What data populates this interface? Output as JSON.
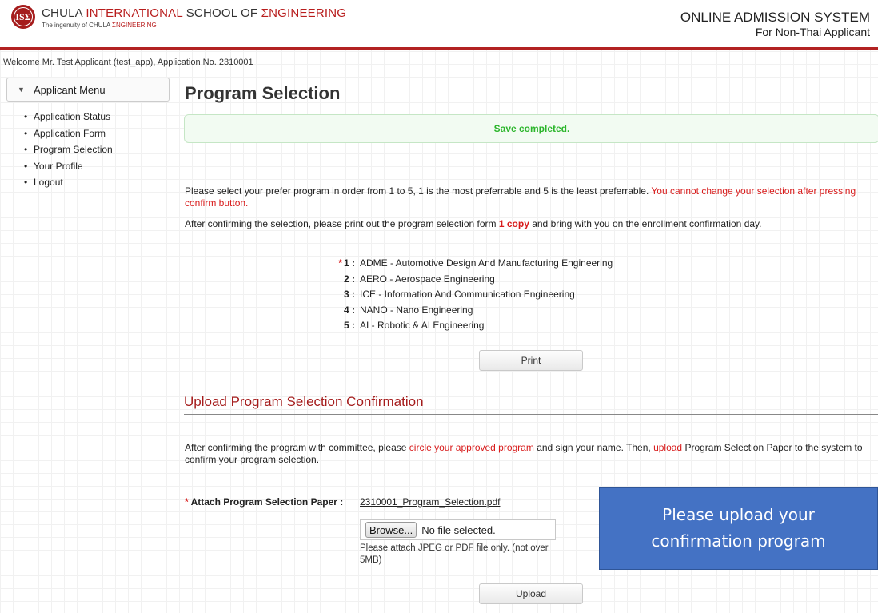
{
  "header": {
    "logo_text": "ISΣ",
    "school_name_black1": "CHULA ",
    "school_name_red1": "INTERNATIONAL",
    "school_name_black2": " SCHOOL OF ",
    "school_name_red2": "ΣNGINEERING",
    "tagline_black": "The ingenuity of CHULA ",
    "tagline_red": "ΣNGINEERING",
    "system_title": "ONLINE ADMISSION SYSTEM",
    "system_subtitle": "For Non-Thai Applicant",
    "accent_color": "#b22222"
  },
  "welcome": "Welcome Mr. Test Applicant (test_app), Application No. 2310001",
  "sidebar": {
    "title": "Applicant Menu",
    "items": [
      {
        "label": "Application Status"
      },
      {
        "label": "Application Form"
      },
      {
        "label": "Program Selection"
      },
      {
        "label": "Your Profile"
      },
      {
        "label": "Logout"
      }
    ]
  },
  "main": {
    "title": "Program Selection",
    "alert": "Save completed.",
    "instruction_text": "Please select your prefer program in order from 1 to 5, 1 is the most preferrable and 5 is the least preferrable. ",
    "instruction_warning": "You cannot change your selection after pressing confirm button.",
    "print_note_before": "After confirming the selection, please print out the program selection form ",
    "print_note_copy": "1 copy",
    "print_note_after": " and bring with you on the enrollment confirmation day.",
    "programs": [
      {
        "rank": "1 :",
        "required": true,
        "name": "ADME - Automotive Design And Manufacturing Engineering"
      },
      {
        "rank": "2 :",
        "required": false,
        "name": "AERO - Aerospace Engineering"
      },
      {
        "rank": "3 :",
        "required": false,
        "name": "ICE - Information And Communication Engineering"
      },
      {
        "rank": "4 :",
        "required": false,
        "name": "NANO - Nano Engineering"
      },
      {
        "rank": "5 :",
        "required": false,
        "name": "AI - Robotic & AI Engineering"
      }
    ],
    "print_button": "Print"
  },
  "upload": {
    "section_title": "Upload Program Selection Confirmation",
    "note_1": "After confirming the program with committee, please ",
    "note_circle": "circle your approved program",
    "note_2": " and sign your name. Then, ",
    "note_upload": "upload",
    "note_3": " Program Selection Paper to the system to confirm your program selection.",
    "attach_label": "Attach Program Selection Paper :",
    "attached_file": "2310001_Program_Selection.pdf",
    "browse_label": "Browse...",
    "no_file_text": "No file selected.",
    "file_hint": "Please attach JPEG or PDF file only. (not over 5MB)",
    "upload_button": "Upload"
  },
  "callout": {
    "line1": "Please upload your",
    "line2": "confirmation program",
    "color": "#4472c4"
  }
}
